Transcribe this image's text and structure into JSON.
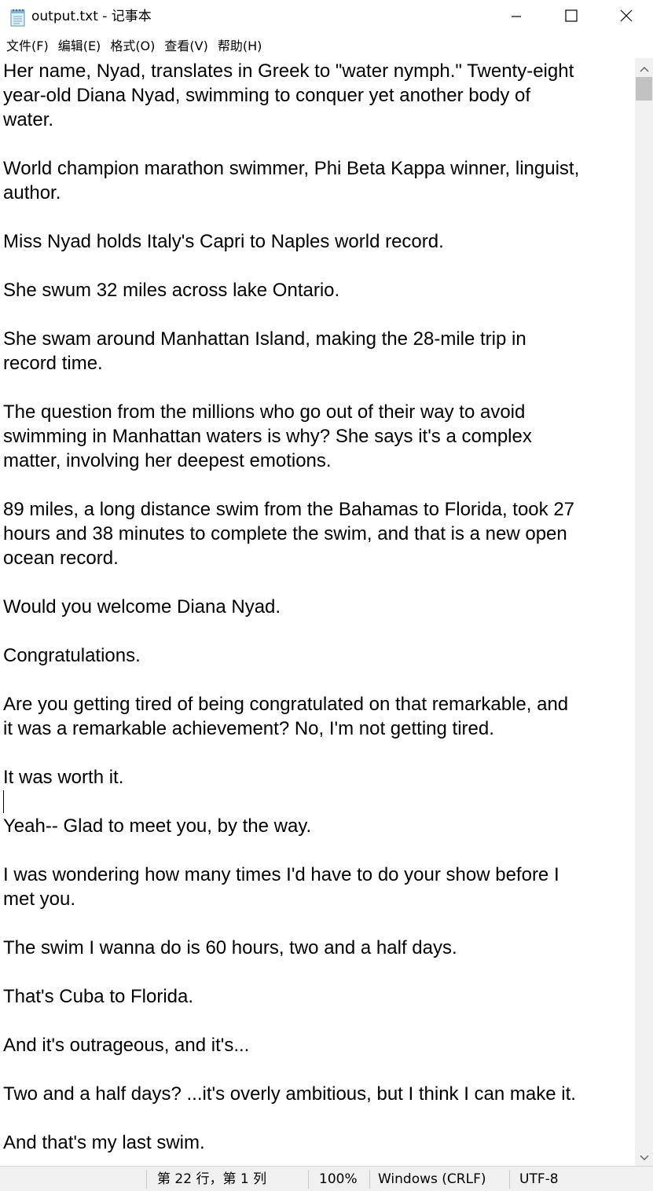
{
  "window": {
    "title": "output.txt - 记事本",
    "icons": {
      "app": "notepad-icon",
      "minimize": "minimize-icon",
      "maximize": "maximize-icon",
      "close": "close-icon"
    }
  },
  "menu": {
    "items": [
      "文件(F)",
      "编辑(E)",
      "格式(O)",
      "查看(V)",
      "帮助(H)"
    ]
  },
  "editor": {
    "lines": [
      "Her name, Nyad, translates in Greek to \"water nymph.\" Twenty-eight",
      "year-old Diana Nyad, swimming to conquer yet another body of",
      "water.",
      "",
      "World champion marathon swimmer, Phi Beta Kappa winner, linguist,",
      "author.",
      "",
      "Miss Nyad holds Italy's Capri to Naples world record.",
      "",
      "She swum 32 miles across lake Ontario.",
      "",
      "She swam around Manhattan Island, making the 28-mile trip in",
      "record time.",
      "",
      "The question from the millions who go out of their way to avoid",
      "swimming in Manhattan waters is why? She says it's a complex",
      "matter, involving her deepest emotions.",
      "",
      "89 miles, a long distance swim from the Bahamas to Florida, took 27",
      "hours and 38 minutes to complete the swim, and that is a new open",
      "ocean record.",
      "",
      "Would you welcome Diana Nyad.",
      "",
      "Congratulations.",
      "",
      "Are you getting tired of being congratulated on that remarkable, and",
      "it was a remarkable achievement? No, I'm not getting tired.",
      "",
      "It was worth it.",
      "",
      "Yeah-- Glad to meet you, by the way.",
      "",
      "I was wondering how many times I'd have to do your show before I",
      "met you.",
      "",
      "The swim I wanna do is 60 hours, two and a half days.",
      "",
      "That's Cuba to Florida.",
      "",
      "And it's outrageous, and it's...",
      "",
      "Two and a half days? ...it's overly ambitious, but I think I can make it.",
      "",
      "And that's my last swim."
    ]
  },
  "scrollbar": {
    "up_icon": "chevron-up-icon",
    "down_icon": "chevron-down-icon"
  },
  "status": {
    "position": "第 22 行，第 1 列",
    "zoom": "100%",
    "line_ending": "Windows (CRLF)",
    "encoding": "UTF-8"
  }
}
